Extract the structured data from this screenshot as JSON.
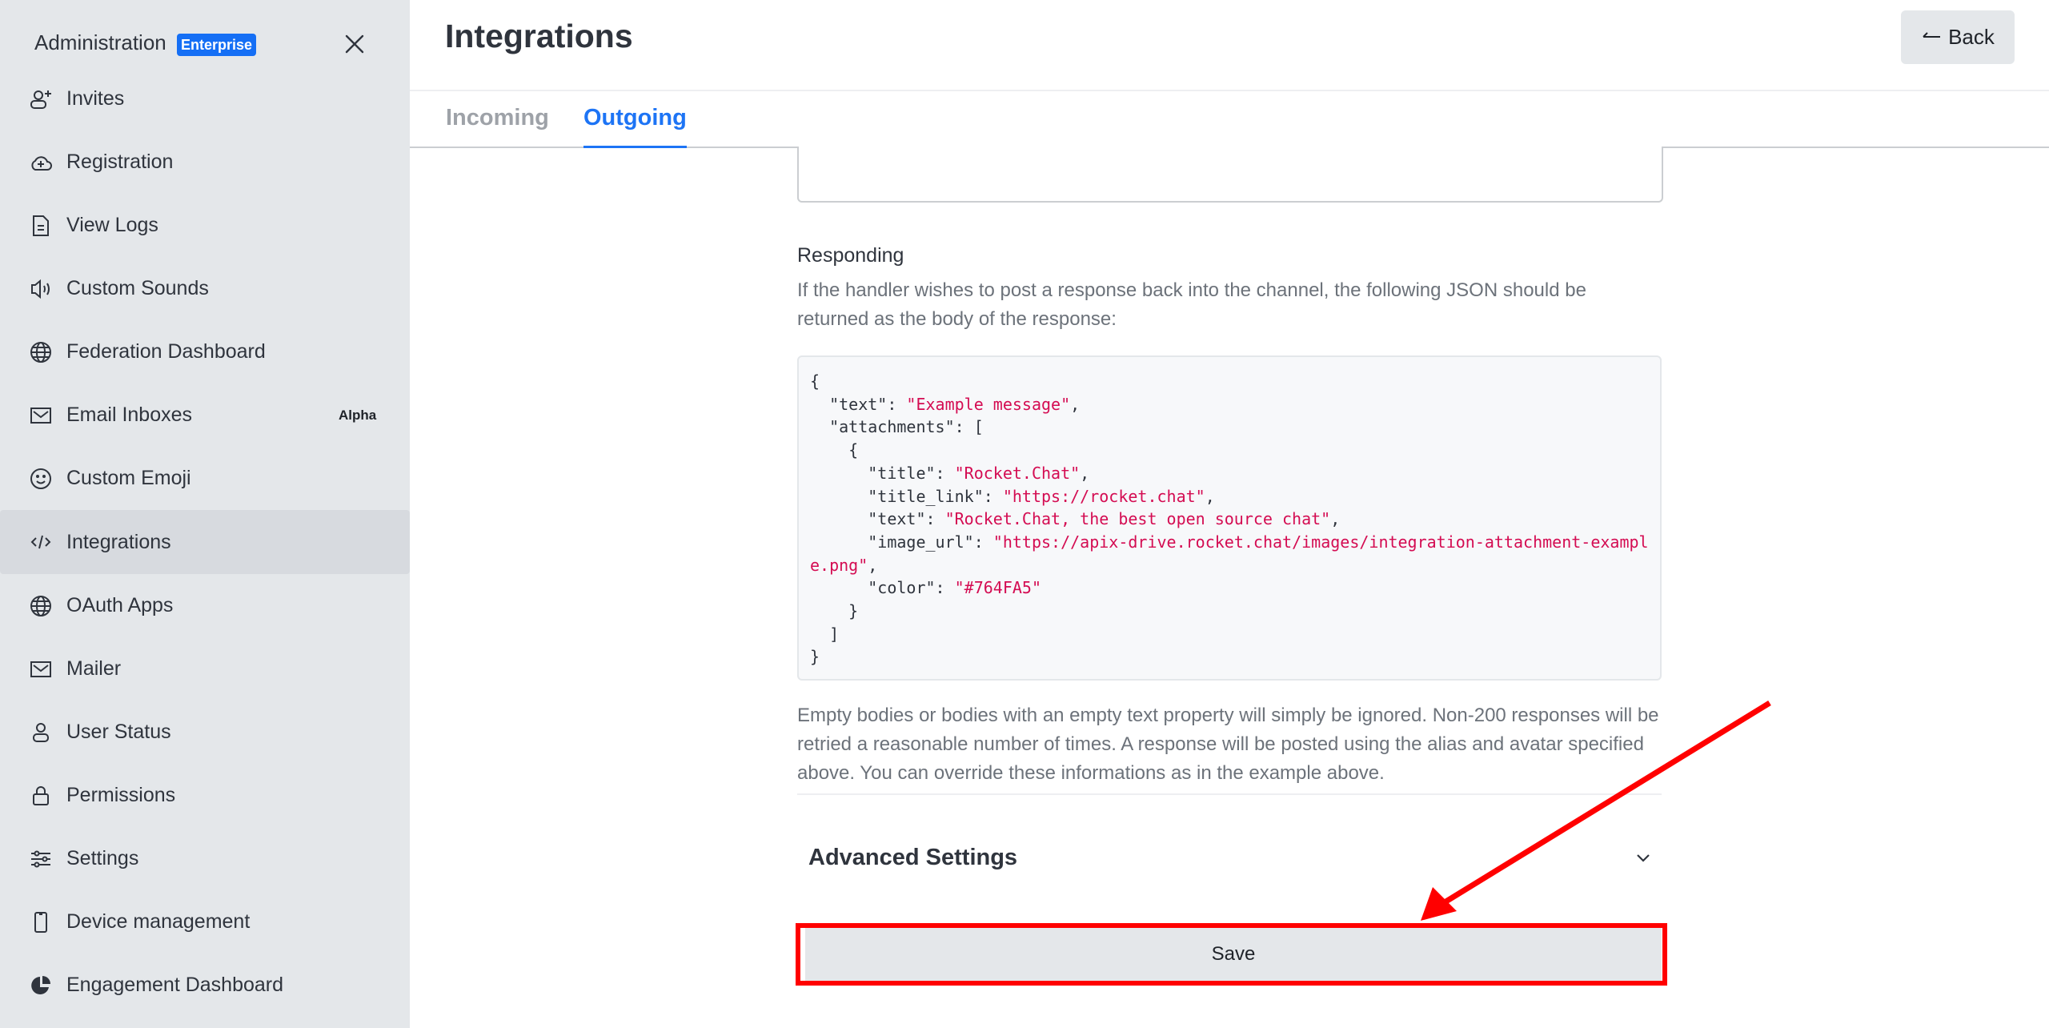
{
  "sidebar": {
    "title": "Administration",
    "badge": "Enterprise",
    "close_icon": "close-icon",
    "items": [
      {
        "label": "Invites",
        "icon": "user-plus-icon"
      },
      {
        "label": "Registration",
        "icon": "cloud-plus-icon"
      },
      {
        "label": "View Logs",
        "icon": "file-icon"
      },
      {
        "label": "Custom Sounds",
        "icon": "speaker-icon"
      },
      {
        "label": "Federation Dashboard",
        "icon": "globe-icon"
      },
      {
        "label": "Email Inboxes",
        "icon": "mail-icon",
        "tag": "Alpha"
      },
      {
        "label": "Custom Emoji",
        "icon": "emoji-icon"
      },
      {
        "label": "Integrations",
        "icon": "code-icon",
        "active": true
      },
      {
        "label": "OAuth Apps",
        "icon": "globe-icon"
      },
      {
        "label": "Mailer",
        "icon": "mail-icon"
      },
      {
        "label": "User Status",
        "icon": "user-icon"
      },
      {
        "label": "Permissions",
        "icon": "lock-icon"
      },
      {
        "label": "Settings",
        "icon": "sliders-icon"
      },
      {
        "label": "Device management",
        "icon": "mobile-icon"
      },
      {
        "label": "Engagement Dashboard",
        "icon": "pie-chart-icon"
      }
    ]
  },
  "header": {
    "title": "Integrations",
    "back_label": "Back",
    "back_icon": "arrow-left-icon"
  },
  "tabs": [
    {
      "label": "Incoming",
      "active": false
    },
    {
      "label": "Outgoing",
      "active": true
    }
  ],
  "responding": {
    "label": "Responding",
    "description": "If the handler wishes to post a response back into the channel, the following JSON should be returned as the body of the response:",
    "code_lines": [
      [
        {
          "t": "{"
        }
      ],
      [
        {
          "t": "  \"text\": "
        },
        {
          "t": "\"Example message\"",
          "s": true
        },
        {
          "t": ","
        }
      ],
      [
        {
          "t": "  \"attachments\": ["
        }
      ],
      [
        {
          "t": "    {"
        }
      ],
      [
        {
          "t": "      \"title\": "
        },
        {
          "t": "\"Rocket.Chat\"",
          "s": true
        },
        {
          "t": ","
        }
      ],
      [
        {
          "t": "      \"title_link\": "
        },
        {
          "t": "\"https://rocket.chat\"",
          "s": true
        },
        {
          "t": ","
        }
      ],
      [
        {
          "t": "      \"text\": "
        },
        {
          "t": "\"Rocket.Chat, the best open source chat\"",
          "s": true
        },
        {
          "t": ","
        }
      ],
      [
        {
          "t": "      \"image_url\": "
        },
        {
          "t": "\"https://apix-drive.rocket.chat/images/integration-attachment-example.png\"",
          "s": true
        },
        {
          "t": ","
        }
      ],
      [
        {
          "t": "      \"color\": "
        },
        {
          "t": "\"#764FA5\"",
          "s": true
        }
      ],
      [
        {
          "t": "    }"
        }
      ],
      [
        {
          "t": "  ]"
        }
      ],
      [
        {
          "t": "}"
        }
      ]
    ],
    "footer": "Empty bodies or bodies with an empty text property will simply be ignored. Non-200 responses will be retried a reasonable number of times. A response will be posted using the alias and avatar specified above. You can override these informations as in the example above."
  },
  "advanced": {
    "title": "Advanced Settings",
    "icon": "chevron-down-icon"
  },
  "save_label": "Save",
  "colors": {
    "accent": "#1d74f5",
    "badge": "#156ff5",
    "code_string": "#d40c52",
    "annotation": "#ff0000"
  }
}
